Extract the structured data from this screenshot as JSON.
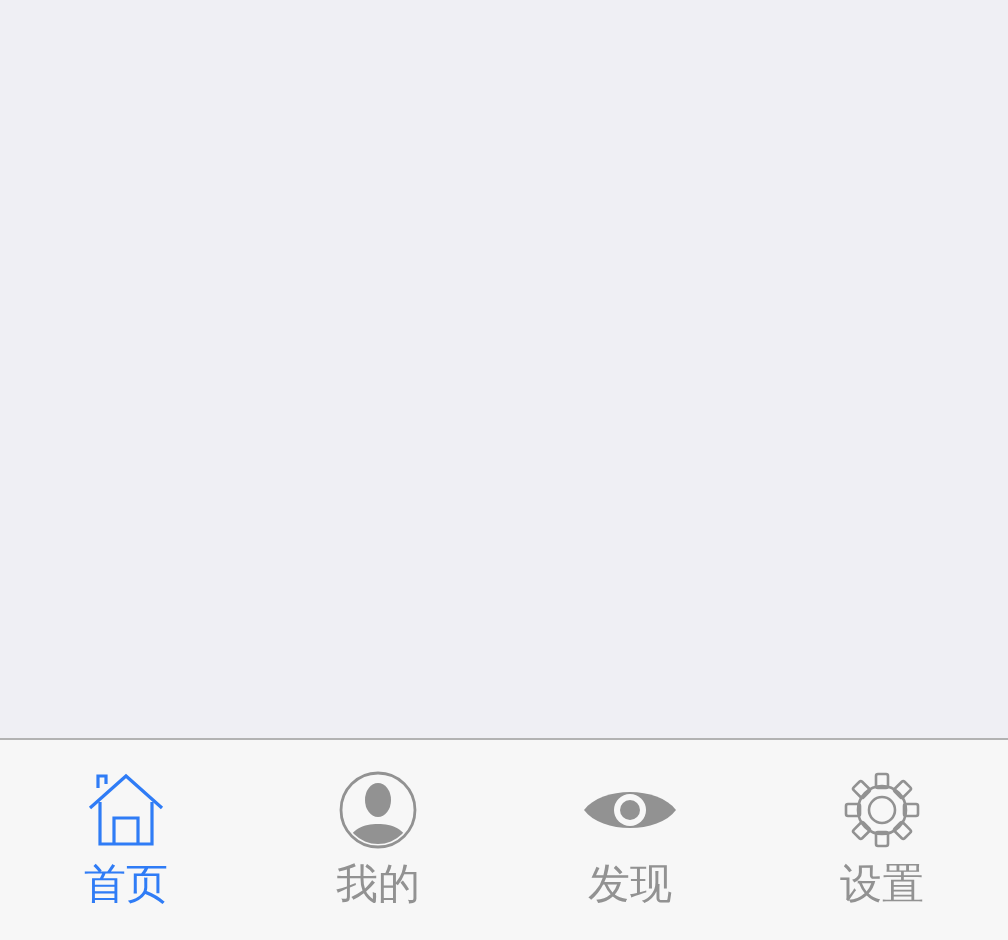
{
  "tab_bar": {
    "tabs": [
      {
        "kind": "home",
        "label": "首页",
        "selected": true
      },
      {
        "kind": "profile",
        "label": "我的",
        "selected": false
      },
      {
        "kind": "discover",
        "label": "发现",
        "selected": false
      },
      {
        "kind": "settings",
        "label": "设置",
        "selected": false
      }
    ]
  }
}
